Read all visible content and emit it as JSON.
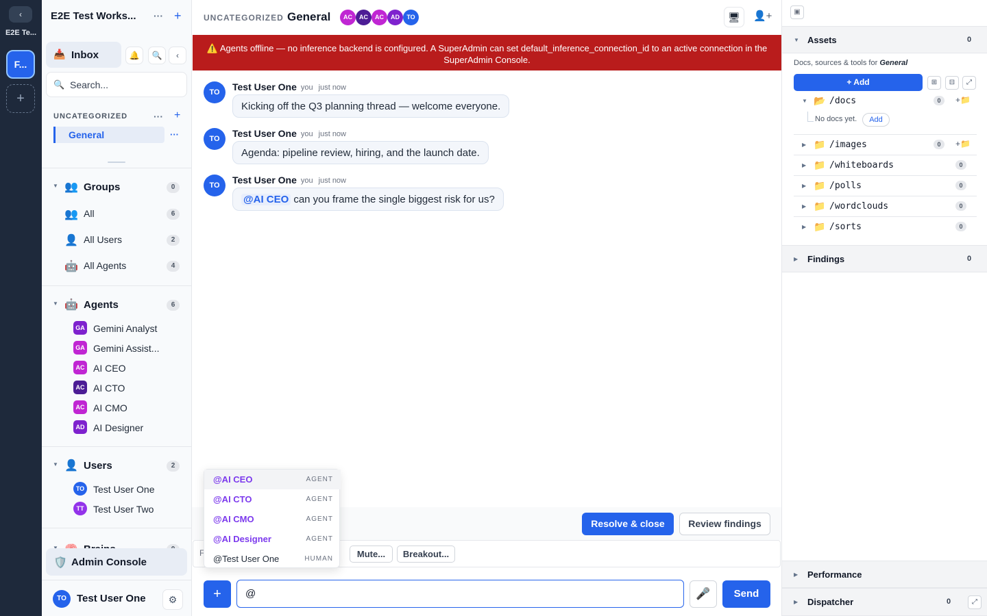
{
  "rail": {
    "back_icon": "‹",
    "workspace_label": "E2E Te...",
    "workspace_initials": "F...",
    "add_icon": "+"
  },
  "sidebar": {
    "workspace_title": "E2E Test Works...",
    "more_icon": "···",
    "plus_icon": "+",
    "inbox_label": "Inbox",
    "search_placeholder": "Search...",
    "category": "UNCATEGORIZED",
    "active_channel": "General",
    "channel_more": "···",
    "groups": {
      "label": "Groups",
      "count": "0",
      "items": [
        {
          "label": "All",
          "count": "6"
        },
        {
          "label": "All Users",
          "count": "2"
        },
        {
          "label": "All Agents",
          "count": "4"
        }
      ]
    },
    "agents": {
      "label": "Agents",
      "count": "6",
      "items": [
        {
          "initials": "GA",
          "label": "Gemini Analyst",
          "color": "#7e22ce"
        },
        {
          "initials": "GA",
          "label": "Gemini Assist...",
          "color": "#c026d3"
        },
        {
          "initials": "AC",
          "label": "AI CEO",
          "color": "#c026d3"
        },
        {
          "initials": "AC",
          "label": "AI CTO",
          "color": "#4c1d95"
        },
        {
          "initials": "AC",
          "label": "AI CMO",
          "color": "#c026d3"
        },
        {
          "initials": "AD",
          "label": "AI Designer",
          "color": "#7e22ce"
        }
      ]
    },
    "users": {
      "label": "Users",
      "count": "2",
      "items": [
        {
          "initials": "TO",
          "label": "Test User One",
          "color": "#2563eb"
        },
        {
          "initials": "TT",
          "label": "Test User Two",
          "color": "#9333ea"
        }
      ]
    },
    "brains": {
      "label": "Brains",
      "count": "0"
    },
    "admin_label": "Admin Console",
    "current_user": {
      "initials": "TO",
      "name": "Test User One"
    }
  },
  "main": {
    "breadcrumb": "UNCATEGORIZED",
    "breadcrumb_sep": "/",
    "title": "General",
    "members": [
      {
        "initials": "AC",
        "color": "#c026d3"
      },
      {
        "initials": "AC",
        "color": "#4c1d95"
      },
      {
        "initials": "AC",
        "color": "#c026d3"
      },
      {
        "initials": "AD",
        "color": "#7e22ce"
      },
      {
        "initials": "TO",
        "color": "#2563eb"
      }
    ],
    "banner": "⚠️ Agents offline — no inference backend is configured. A SuperAdmin can set default_inference_connection_id to an active connection in the SuperAdmin Console.",
    "messages": [
      {
        "initials": "TO",
        "author": "Test User One",
        "you": "you",
        "time": "just now",
        "mention": "",
        "text": "Kicking off the Q3 planning thread — welcome everyone."
      },
      {
        "initials": "TO",
        "author": "Test User One",
        "you": "you",
        "time": "just now",
        "mention": "",
        "text": "Agenda: pipeline review, hiring, and the launch date."
      },
      {
        "initials": "TO",
        "author": "Test User One",
        "you": "you",
        "time": "just now",
        "mention": "@AI CEO",
        "text": "can you frame the single biggest risk for us?"
      }
    ],
    "resolve_label": "Resolve & close",
    "review_label": "Review findings",
    "chips": {
      "first": "F",
      "mute": "Mute...",
      "breakout": "Breakout..."
    },
    "mention_options": [
      {
        "label": "@AI CEO",
        "kind": "AGENT"
      },
      {
        "label": "@AI CTO",
        "kind": "AGENT"
      },
      {
        "label": "@AI CMO",
        "kind": "AGENT"
      },
      {
        "label": "@AI Designer",
        "kind": "AGENT"
      },
      {
        "label": "@Test User One",
        "kind": "HUMAN"
      }
    ],
    "composer_value": "@",
    "send_label": "Send"
  },
  "right": {
    "assets": {
      "label": "Assets",
      "count": "0"
    },
    "subtitle_prefix": "Docs, sources & tools for ",
    "subtitle_channel": "General",
    "add_label": "+ Add",
    "folders": [
      {
        "name": "/docs",
        "count": "0"
      },
      {
        "name": "/images",
        "count": "0"
      },
      {
        "name": "/whiteboards",
        "count": "0"
      },
      {
        "name": "/polls",
        "count": "0"
      },
      {
        "name": "/wordclouds",
        "count": "0"
      },
      {
        "name": "/sorts",
        "count": "0"
      }
    ],
    "no_docs": "No docs yet.",
    "no_docs_add": "Add",
    "findings": {
      "label": "Findings",
      "count": "0"
    },
    "performance": {
      "label": "Performance"
    },
    "dispatcher": {
      "label": "Dispatcher",
      "count": "0"
    }
  }
}
